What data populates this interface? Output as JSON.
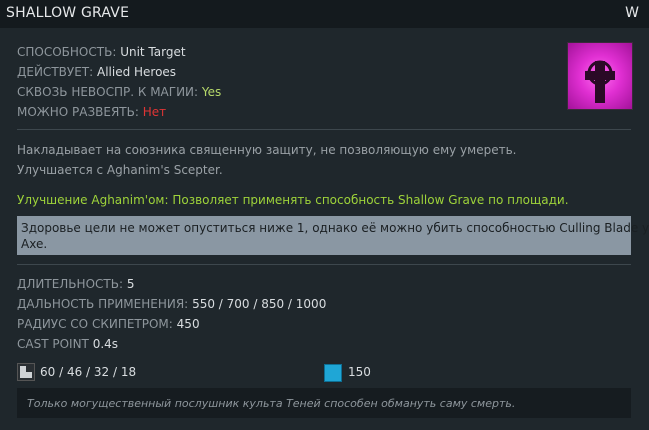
{
  "header": {
    "title": "SHALLOW GRAVE",
    "hotkey": "W"
  },
  "icon": {
    "name": "shallow-grave-cross-icon",
    "bg_color": "#e02fd2"
  },
  "stats": [
    {
      "label": "СПОСОБНОСТЬ:",
      "value": "Unit Target"
    },
    {
      "label": "ДЕЙСТВУЕТ:",
      "value": "Allied Heroes"
    },
    {
      "label": "СКВОЗЬ НЕВОСПР. К МАГИИ:",
      "value": "Yes"
    },
    {
      "label": "МОЖНО РАЗВЕЯТЬ:",
      "value": "Нет"
    }
  ],
  "description": {
    "line1": "Накладывает на союзника священную защиту, не позволяющую ему умереть.",
    "line2": "Улучшается с Aghanim's Scepter."
  },
  "upgrade": "Улучшение Aghanim'ом: Позволяет применять способность Shallow Grave по площади.",
  "scepter_note": {
    "line1": "Здоровье цели не может опуститься ниже 1, однако её можно убить способностью Culling Blade у",
    "line2": "Axe."
  },
  "details": [
    {
      "label": "ДЛИТЕЛЬНОСТЬ:",
      "value": "5"
    },
    {
      "label": "ДАЛЬНОСТЬ ПРИМЕНЕНИЯ:",
      "value": "550 / 700 / 850 / 1000"
    },
    {
      "label": "РАДИУС СО СКИПЕТРОМ:",
      "value": "450"
    },
    {
      "label": "CAST POINT",
      "value": "0.4s"
    }
  ],
  "costs": {
    "cooldown": "60 / 46 / 32 / 18",
    "mana": "150",
    "mana_color": "#1fa6d6"
  },
  "lore": "Только могущественный послушник культа Теней способен обмануть саму смерть."
}
